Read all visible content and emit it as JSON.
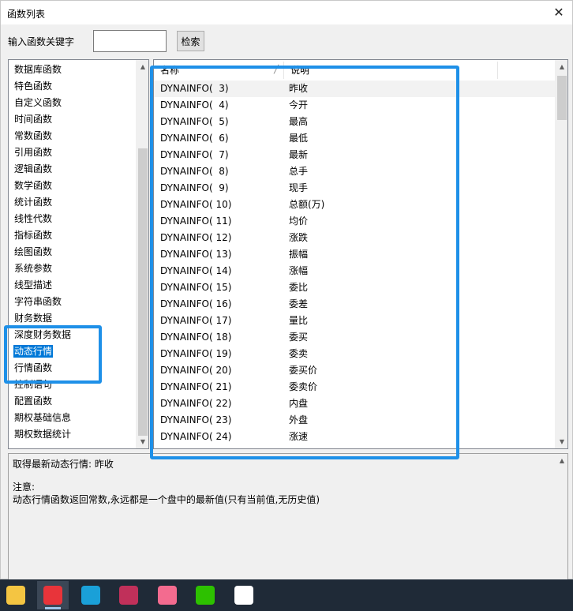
{
  "window": {
    "title": "函数列表",
    "close_glyph": "✕"
  },
  "search": {
    "label": "输入函数关键字",
    "value": "",
    "button_label": "检索"
  },
  "categories": [
    {
      "label": "数据库函数"
    },
    {
      "label": "特色函数"
    },
    {
      "label": "自定义函数"
    },
    {
      "label": "时间函数"
    },
    {
      "label": "常数函数"
    },
    {
      "label": "引用函数"
    },
    {
      "label": "逻辑函数"
    },
    {
      "label": "数学函数"
    },
    {
      "label": "统计函数"
    },
    {
      "label": "线性代数"
    },
    {
      "label": "指标函数"
    },
    {
      "label": "绘图函数"
    },
    {
      "label": "系统参数"
    },
    {
      "label": "线型描述"
    },
    {
      "label": "字符串函数"
    },
    {
      "label": "财务数据"
    },
    {
      "label": "深度财务数据"
    },
    {
      "label": "动态行情"
    },
    {
      "label": "行情函数"
    },
    {
      "label": "控制语句"
    },
    {
      "label": "配置函数"
    },
    {
      "label": "期权基础信息"
    },
    {
      "label": "期权数据统计"
    }
  ],
  "selected_category": "动态行情",
  "table": {
    "columns": [
      "名称",
      "说明",
      ""
    ],
    "rows": [
      {
        "name": "DYNAINFO(  3)",
        "desc": "昨收"
      },
      {
        "name": "DYNAINFO(  4)",
        "desc": "今开"
      },
      {
        "name": "DYNAINFO(  5)",
        "desc": "最高"
      },
      {
        "name": "DYNAINFO(  6)",
        "desc": "最低"
      },
      {
        "name": "DYNAINFO(  7)",
        "desc": "最新"
      },
      {
        "name": "DYNAINFO(  8)",
        "desc": "总手"
      },
      {
        "name": "DYNAINFO(  9)",
        "desc": "现手"
      },
      {
        "name": "DYNAINFO( 10)",
        "desc": "总额(万)"
      },
      {
        "name": "DYNAINFO( 11)",
        "desc": "均价"
      },
      {
        "name": "DYNAINFO( 12)",
        "desc": "涨跌"
      },
      {
        "name": "DYNAINFO( 13)",
        "desc": "振幅"
      },
      {
        "name": "DYNAINFO( 14)",
        "desc": "涨幅"
      },
      {
        "name": "DYNAINFO( 15)",
        "desc": "委比"
      },
      {
        "name": "DYNAINFO( 16)",
        "desc": "委差"
      },
      {
        "name": "DYNAINFO( 17)",
        "desc": "量比"
      },
      {
        "name": "DYNAINFO( 18)",
        "desc": "委买"
      },
      {
        "name": "DYNAINFO( 19)",
        "desc": "委卖"
      },
      {
        "name": "DYNAINFO( 20)",
        "desc": "委买价"
      },
      {
        "name": "DYNAINFO( 21)",
        "desc": "委卖价"
      },
      {
        "name": "DYNAINFO( 22)",
        "desc": "内盘"
      },
      {
        "name": "DYNAINFO( 23)",
        "desc": "外盘"
      },
      {
        "name": "DYNAINFO( 24)",
        "desc": "涨速"
      }
    ]
  },
  "description": {
    "summary": "取得最新动态行情: 昨收",
    "note_title": "注意:",
    "note_text": "动态行情函数返回常数,永远都是一个盘中的最新值(只有当前值,无历史值)"
  },
  "taskbar": {
    "items": [
      {
        "icon": "file-explorer-icon",
        "color": "#f4c542"
      },
      {
        "icon": "stock-app-icon",
        "color": "#e8343a"
      },
      {
        "icon": "edge-browser-icon",
        "color": "#1aa0d8"
      },
      {
        "icon": "rider-ide-icon",
        "color": "#c0305a"
      },
      {
        "icon": "bilibili-icon",
        "color": "#f36b8f"
      },
      {
        "icon": "wechat-icon",
        "color": "#2dc100"
      },
      {
        "icon": "qq-icon",
        "color": "#ffffff"
      }
    ]
  },
  "colors": {
    "selection": "#0078d7",
    "annotation": "#1e90e8"
  }
}
